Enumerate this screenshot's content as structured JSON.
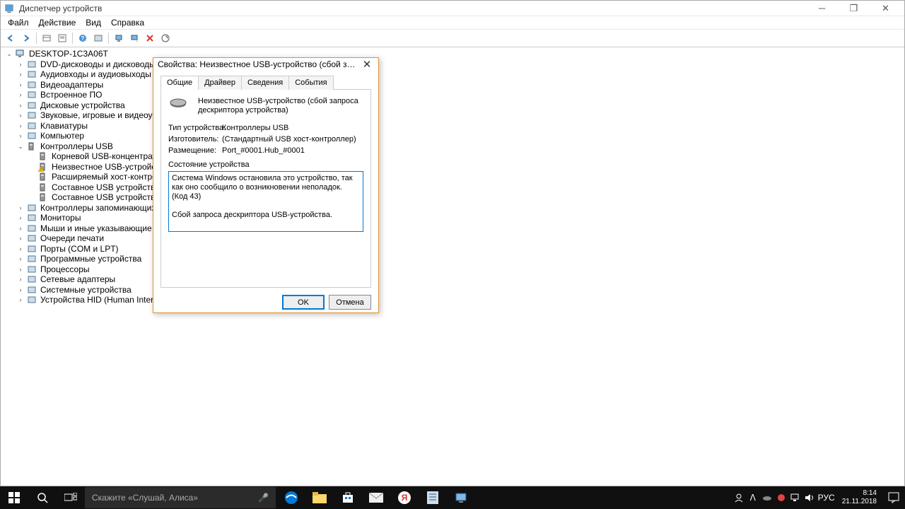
{
  "window": {
    "title": "Диспетчер устройств"
  },
  "menu": {
    "file": "Файл",
    "action": "Действие",
    "view": "Вид",
    "help": "Справка"
  },
  "tree": {
    "root": "DESKTOP-1C3A06T",
    "items": [
      "DVD-дисководы и дисководы компа",
      "Аудиовходы и аудиовыходы",
      "Видеоадаптеры",
      "Встроенное ПО",
      "Дисковые устройства",
      "Звуковые, игровые и видеоустройст",
      "Клавиатуры",
      "Компьютер",
      "Контроллеры USB",
      "Контроллеры запоминающих устро",
      "Мониторы",
      "Мыши и иные указывающие устрой",
      "Очереди печати",
      "Порты (COM и LPT)",
      "Программные устройства",
      "Процессоры",
      "Сетевые адаптеры",
      "Системные устройства",
      "Устройства HID (Human Interface Dev"
    ],
    "usb_children": [
      "Корневой USB-концентратор (USB",
      "Неизвестное USB-устройство (сбо",
      "Расширяемый хост-контроллер I",
      "Составное USB устройство",
      "Составное USB устройство"
    ]
  },
  "modal": {
    "title": "Свойства: Неизвестное USB-устройство (сбой запроса дескрип...",
    "tabs": {
      "general": "Общие",
      "driver": "Драйвер",
      "details": "Сведения",
      "events": "События"
    },
    "device_name": "Неизвестное USB-устройство (сбой запроса дескриптора устройства)",
    "type_label": "Тип устройства:",
    "type_val": "Контроллеры USB",
    "mfg_label": "Изготовитель:",
    "mfg_val": "(Стандартный USB хост-контроллер)",
    "loc_label": "Размещение:",
    "loc_val": "Port_#0001.Hub_#0001",
    "status_label": "Состояние устройства",
    "status_text": "Система Windows остановила это устройство, так как оно сообщило о возникновении неполадок. (Код 43)\n\nСбой запроса дескриптора USB-устройства.",
    "ok": "OK",
    "cancel": "Отмена"
  },
  "taskbar": {
    "cortana": "Скажите «Слушай, Алиса»",
    "lang": "РУС",
    "time": "8:14",
    "date": "21.11.2018"
  }
}
